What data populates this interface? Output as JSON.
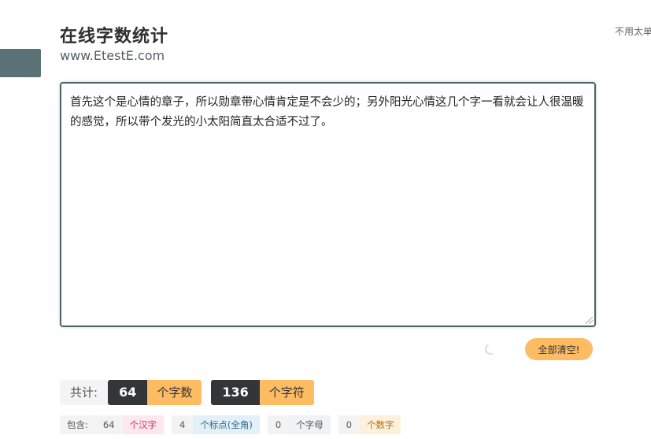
{
  "header": {
    "title": "在线字数统计",
    "subtitle": "www.EtestE.com",
    "top_note": "不用太",
    "top_note_cut": "单"
  },
  "editor": {
    "text": "首先这个是心情的章子，所以勋章带心情肯定是不会少的；另外阳光心情这几个字一看就会让人很温暖的感觉，所以带个发光的小太阳简直太合适不过了。"
  },
  "actions": {
    "clear_label": "全部清空!"
  },
  "totals": {
    "label": "共计:",
    "chars_value": "64",
    "chars_unit": "个字数",
    "symbols_value": "136",
    "symbols_unit": "个字符"
  },
  "details": {
    "label": "包含:",
    "hanzi_value": "64",
    "hanzi_unit": "个汉字",
    "punct_value": "4",
    "punct_unit": "个标点(全角)",
    "letters_value": "0",
    "letters_unit": "个字母",
    "digits_value": "0",
    "digits_unit": "个数字"
  },
  "colors": {
    "accent": "#fdbb63",
    "dark": "#333538",
    "sidebar_tab": "#587277"
  }
}
